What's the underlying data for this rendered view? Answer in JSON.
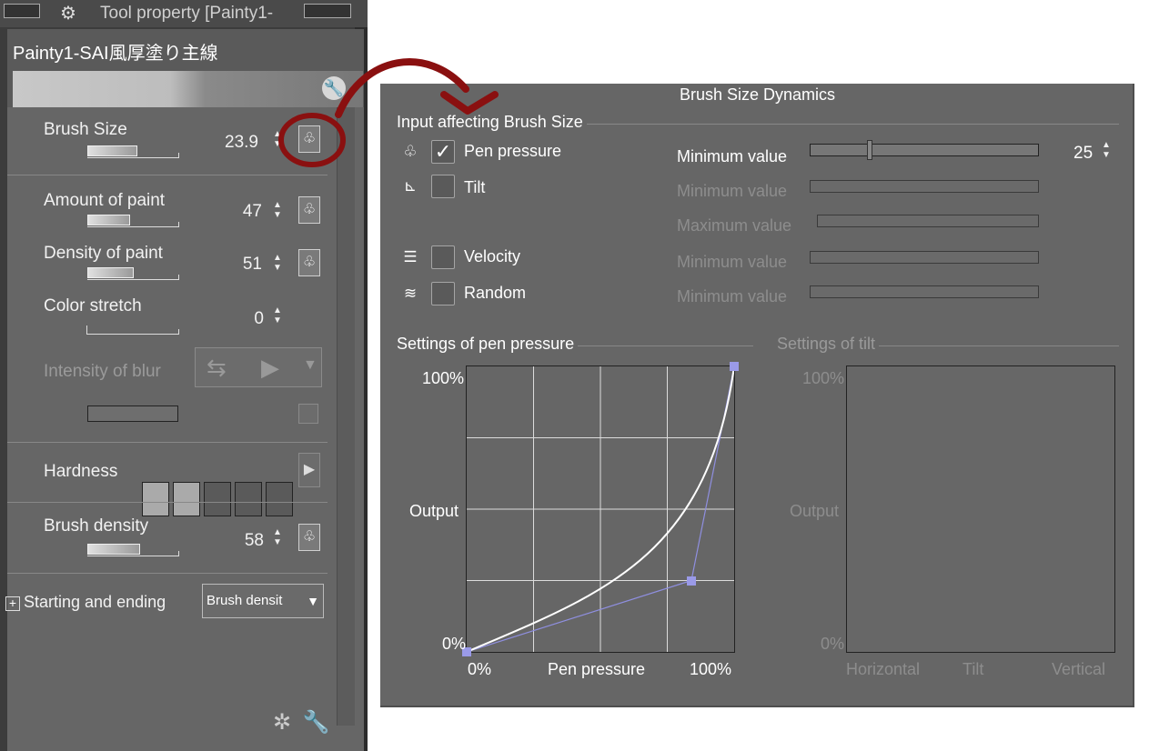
{
  "tool_panel": {
    "title": "Tool property [Painty1-",
    "brush_name": "Painty1-SAI風厚塗り主線",
    "properties": [
      {
        "label": "Brush Size",
        "value": "23.9",
        "fill_fraction": 0.55
      },
      {
        "label": "Amount of paint",
        "value": "47",
        "fill_fraction": 0.47
      },
      {
        "label": "Density of paint",
        "value": "51",
        "fill_fraction": 0.51
      },
      {
        "label": "Color stretch",
        "value": "0",
        "fill_fraction": 0.0
      },
      {
        "label": "Intensity of blur",
        "value": "",
        "fill_fraction": 0.0
      },
      {
        "label": "Brush density",
        "value": "58",
        "fill_fraction": 0.58
      }
    ],
    "hardness_label": "Hardness",
    "hardness_level": 2,
    "hardness_steps": 5,
    "starting_ending_label": "Starting and ending",
    "starting_ending_value": "Brush densit"
  },
  "dynamics": {
    "title": "Brush Size Dynamics",
    "input_group_title": "Input affecting Brush Size",
    "inputs": [
      {
        "label": "Pen pressure",
        "checked": true,
        "icon": "pen-pressure-icon",
        "sliders": [
          {
            "label": "Minimum value",
            "value": "25",
            "enabled": true
          }
        ]
      },
      {
        "label": "Tilt",
        "checked": false,
        "icon": "tilt-icon",
        "sliders": [
          {
            "label": "Minimum value",
            "enabled": false
          },
          {
            "label": "Maximum value",
            "enabled": false
          }
        ]
      },
      {
        "label": "Velocity",
        "checked": false,
        "icon": "velocity-icon",
        "sliders": [
          {
            "label": "Minimum value",
            "enabled": false
          }
        ]
      },
      {
        "label": "Random",
        "checked": false,
        "icon": "random-icon",
        "sliders": [
          {
            "label": "Minimum value",
            "enabled": false
          }
        ]
      }
    ],
    "min_value": "25",
    "pressure_group_title": "Settings of pen pressure",
    "tilt_group_title": "Settings of tilt",
    "pressure_graph": {
      "y_top": "100%",
      "y_mid": "Output",
      "y_bottom": "0%",
      "x_left": "0%",
      "x_mid": "Pen pressure",
      "x_right": "100%",
      "control_points": [
        [
          0,
          0
        ],
        [
          0.84,
          0.25
        ],
        [
          1,
          1
        ]
      ]
    },
    "tilt_graph": {
      "y_top": "100%",
      "y_mid": "Output",
      "y_bottom": "0%",
      "x_left": "Horizontal",
      "x_mid": "Tilt",
      "x_right": "Vertical"
    }
  }
}
